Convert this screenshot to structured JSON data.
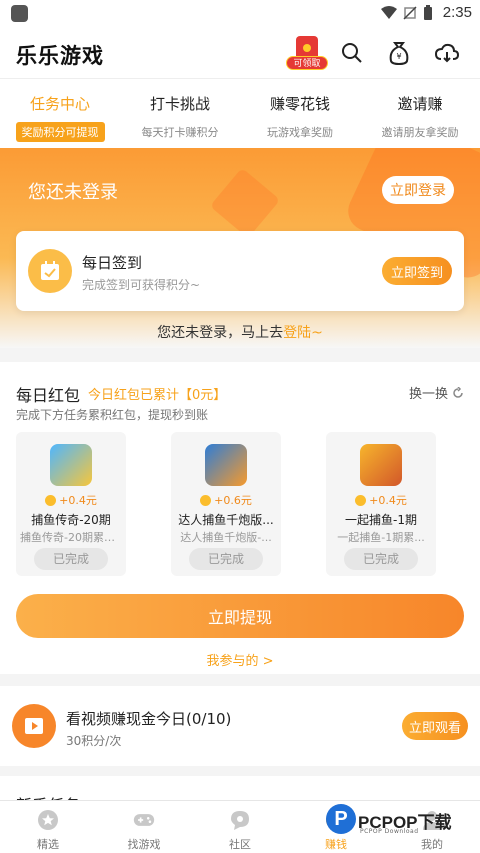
{
  "status_bar": {
    "time": "2:35"
  },
  "header": {
    "title": "乐乐游戏",
    "redpack_tag": "可领取"
  },
  "tabs": [
    {
      "title": "任务中心",
      "sub": "奖励积分可提现",
      "active": true
    },
    {
      "title": "打卡挑战",
      "sub": "每天打卡赚积分",
      "active": false
    },
    {
      "title": "赚零花钱",
      "sub": "玩游戏拿奖励",
      "active": false
    },
    {
      "title": "邀请赚",
      "sub": "邀请朋友拿奖励",
      "active": false
    }
  ],
  "banner": {
    "login_tip": "您还未登录",
    "login_button": "立即登录"
  },
  "sign_card": {
    "title": "每日签到",
    "subtitle": "完成签到可获得积分~",
    "button": "立即签到"
  },
  "login_hint": {
    "text": "您还未登录，马上去",
    "link": "登陆~"
  },
  "redpack": {
    "title": "每日红包",
    "total": "今日红包已累计【0元】",
    "refresh": "换一换",
    "desc": "完成下方任务累积红包，提现秒到账",
    "games": [
      {
        "reward": "+0.4元",
        "name": "捕鱼传奇-20期",
        "sub": "捕鱼传奇-20期累计...",
        "status": "已完成"
      },
      {
        "reward": "+0.6元",
        "name": "达人捕鱼千炮版...",
        "sub": "达人捕鱼千炮版-...",
        "status": "已完成"
      },
      {
        "reward": "+0.4元",
        "name": "一起捕鱼-1期",
        "sub": "一起捕鱼-1期累...",
        "status": "已完成"
      }
    ],
    "withdraw_button": "立即提现",
    "mine_link": "我参与的 >"
  },
  "video": {
    "title": "看视频赚现金今日(0/10)",
    "subtitle": "30积分/次",
    "button": "立即观看"
  },
  "newbie": {
    "title": "新手任务"
  },
  "bottom_nav": [
    {
      "label": "精选",
      "icon": "star-icon"
    },
    {
      "label": "找游戏",
      "icon": "gamepad-icon"
    },
    {
      "label": "社区",
      "icon": "chat-icon"
    },
    {
      "label": "赚钱",
      "icon": "coin-icon",
      "active": true
    },
    {
      "label": "我的",
      "icon": "user-icon"
    }
  ],
  "watermark": {
    "brand": "PCPOP下载",
    "sub": "PCPOP Download",
    "logo_letter": "P"
  },
  "colors": {
    "accent": "#f7a21b",
    "accent_dark": "#f7862a",
    "banner_top": "#fb9b35"
  }
}
